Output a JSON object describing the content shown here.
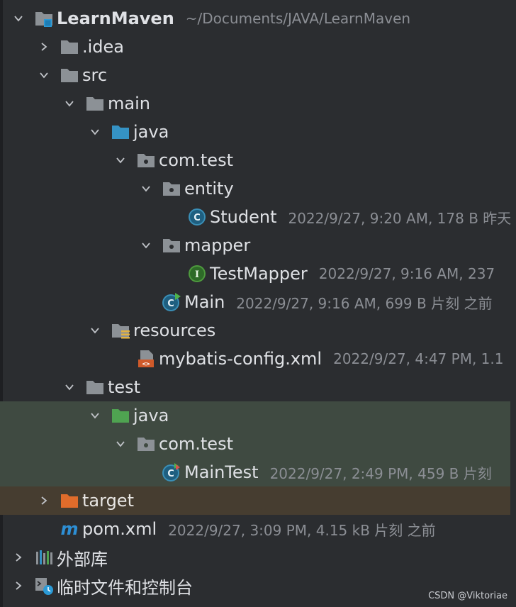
{
  "tree": {
    "root": {
      "label": "LearnMaven",
      "meta": "~/Documents/JAVA/LearnMaven"
    },
    "idea": {
      "label": ".idea"
    },
    "src": {
      "label": "src"
    },
    "main": {
      "label": "main"
    },
    "main_java": {
      "label": "java"
    },
    "com_test": {
      "label": "com.test"
    },
    "entity": {
      "label": "entity"
    },
    "student": {
      "label": "Student",
      "meta": "2022/9/27, 9:20 AM, 178 B 昨天"
    },
    "mapper": {
      "label": "mapper"
    },
    "testmapper": {
      "label": "TestMapper",
      "meta": "2022/9/27, 9:16 AM, 237"
    },
    "main_class": {
      "label": "Main",
      "meta": "2022/9/27, 9:16 AM, 699 B 片刻 之前"
    },
    "resources": {
      "label": "resources"
    },
    "mybatis": {
      "label": "mybatis-config.xml",
      "meta": "2022/9/27, 4:47 PM, 1.1"
    },
    "test": {
      "label": "test"
    },
    "test_java": {
      "label": "java"
    },
    "test_com_test": {
      "label": "com.test"
    },
    "maintest": {
      "label": "MainTest",
      "meta": "2022/9/27, 2:49 PM, 459 B 片刻"
    },
    "target": {
      "label": "target"
    },
    "pom": {
      "label": "pom.xml",
      "meta": "2022/9/27, 3:09 PM, 4.15 kB 片刻 之前"
    },
    "libs": {
      "label": "外部库"
    },
    "scratches": {
      "label": "临时文件和控制台"
    }
  },
  "watermark": "CSDN @Viktoriae",
  "colors": {
    "folder": "#8c9196",
    "java_source": "#3592c4",
    "java_test": "#4fa351",
    "excluded": "#e06c2b",
    "class_icon": "#3a8fb7",
    "interface_icon": "#4e9a3e",
    "test_bg": "#3f4a41",
    "excluded_bg": "#463d30"
  }
}
